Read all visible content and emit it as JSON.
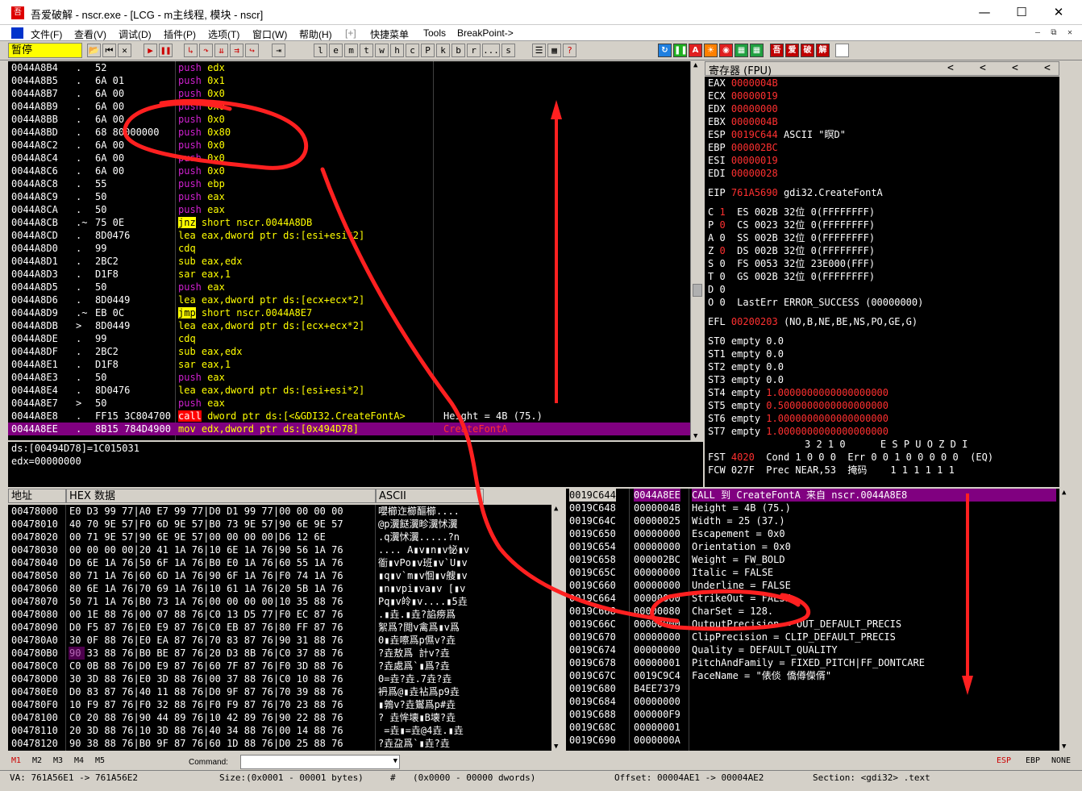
{
  "window": {
    "title": "吾爱破解 - nscr.exe - [LCG - m主线程, 模块 - nscr]",
    "icon_text": "吾",
    "controls": [
      "minimize-icon",
      "maximize-icon",
      "close-icon"
    ]
  },
  "menu": {
    "items": [
      "文件(F)",
      "查看(V)",
      "调试(D)",
      "插件(P)",
      "选项(T)",
      "窗口(W)",
      "帮助(H)",
      "[+]",
      "快捷菜单",
      "Tools",
      "BreakPoint->"
    ]
  },
  "toolbar": {
    "status": "暂停",
    "buttons": [
      "open-icon",
      "rewind-icon",
      "close-icon",
      "run-icon",
      "pause-icon",
      "step-into-icon",
      "step-over-icon",
      "trace-into-icon",
      "trace-over-icon",
      "execute-till-return-icon",
      "goto-icon"
    ],
    "letters": [
      "l",
      "e",
      "m",
      "t",
      "w",
      "h",
      "c",
      "P",
      "k",
      "b",
      "r",
      "...",
      "s"
    ],
    "colored": [
      "吾",
      "爱",
      "破",
      "解"
    ]
  },
  "disasm": {
    "rows": [
      {
        "addr": "0044A8B4",
        "mark": ".",
        "hex": "52",
        "mnem": "push",
        "ops": "edx"
      },
      {
        "addr": "0044A8B5",
        "mark": ".",
        "hex": "6A 01",
        "mnem": "push",
        "ops": "0x1"
      },
      {
        "addr": "0044A8B7",
        "mark": ".",
        "hex": "6A 00",
        "mnem": "push",
        "ops": "0x0"
      },
      {
        "addr": "0044A8B9",
        "mark": ".",
        "hex": "6A 00",
        "mnem": "push",
        "ops": "0x0"
      },
      {
        "addr": "0044A8BB",
        "mark": ".",
        "hex": "6A 00",
        "mnem": "push",
        "ops": "0x0"
      },
      {
        "addr": "0044A8BD",
        "mark": ".",
        "hex": "68 80000000",
        "mnem": "push",
        "ops": "0x80"
      },
      {
        "addr": "0044A8C2",
        "mark": ".",
        "hex": "6A 00",
        "mnem": "push",
        "ops": "0x0"
      },
      {
        "addr": "0044A8C4",
        "mark": ".",
        "hex": "6A 00",
        "mnem": "push",
        "ops": "0x0"
      },
      {
        "addr": "0044A8C6",
        "mark": ".",
        "hex": "6A 00",
        "mnem": "push",
        "ops": "0x0"
      },
      {
        "addr": "0044A8C8",
        "mark": ".",
        "hex": "55",
        "mnem": "push",
        "ops": "ebp"
      },
      {
        "addr": "0044A8C9",
        "mark": ".",
        "hex": "50",
        "mnem": "push",
        "ops": "eax"
      },
      {
        "addr": "0044A8CA",
        "mark": ".",
        "hex": "50",
        "mnem": "push",
        "ops": "eax"
      },
      {
        "addr": "0044A8CB",
        "mark": ".~",
        "hex": "75 0E",
        "mnem": "jnz",
        "ops": "short nscr.0044A8DB"
      },
      {
        "addr": "0044A8CD",
        "mark": ".",
        "hex": "8D0476",
        "mnem": "lea",
        "ops": "eax,dword ptr ds:[esi+esi*2]"
      },
      {
        "addr": "0044A8D0",
        "mark": ".",
        "hex": "99",
        "mnem": "cdq",
        "ops": ""
      },
      {
        "addr": "0044A8D1",
        "mark": ".",
        "hex": "2BC2",
        "mnem": "sub",
        "ops": "eax,edx"
      },
      {
        "addr": "0044A8D3",
        "mark": ".",
        "hex": "D1F8",
        "mnem": "sar",
        "ops": "eax,1"
      },
      {
        "addr": "0044A8D5",
        "mark": ".",
        "hex": "50",
        "mnem": "push",
        "ops": "eax"
      },
      {
        "addr": "0044A8D6",
        "mark": ".",
        "hex": "8D0449",
        "mnem": "lea",
        "ops": "eax,dword ptr ds:[ecx+ecx*2]"
      },
      {
        "addr": "0044A8D9",
        "mark": ".~",
        "hex": "EB 0C",
        "mnem": "jmp",
        "ops": "short nscr.0044A8E7"
      },
      {
        "addr": "0044A8DB",
        "mark": ">",
        "hex": "8D0449",
        "mnem": "lea",
        "ops": "eax,dword ptr ds:[ecx+ecx*2]"
      },
      {
        "addr": "0044A8DE",
        "mark": ".",
        "hex": "99",
        "mnem": "cdq",
        "ops": ""
      },
      {
        "addr": "0044A8DF",
        "mark": ".",
        "hex": "2BC2",
        "mnem": "sub",
        "ops": "eax,edx"
      },
      {
        "addr": "0044A8E1",
        "mark": ".",
        "hex": "D1F8",
        "mnem": "sar",
        "ops": "eax,1"
      },
      {
        "addr": "0044A8E3",
        "mark": ".",
        "hex": "50",
        "mnem": "push",
        "ops": "eax"
      },
      {
        "addr": "0044A8E4",
        "mark": ".",
        "hex": "8D0476",
        "mnem": "lea",
        "ops": "eax,dword ptr ds:[esi+esi*2]"
      },
      {
        "addr": "0044A8E7",
        "mark": ">",
        "hex": "50",
        "mnem": "push",
        "ops": "eax"
      },
      {
        "addr": "0044A8E8",
        "mark": ".",
        "hex": "FF15 3C804700",
        "mnem": "call",
        "ops": "dword ptr ds:[<&GDI32.CreateFontA>"
      },
      {
        "addr": "0044A8EE",
        "mark": ".",
        "hex": "8B15 784D4900",
        "mnem": "mov",
        "ops": "edx,dword ptr ds:[0x494D78]",
        "selected": true
      }
    ],
    "comments": [
      {
        "row": 27,
        "text": "Height = 4B (75.)"
      },
      {
        "row": 28,
        "text": "CreateFontA",
        "red": true
      }
    ]
  },
  "info": {
    "lines": [
      "ds:[00494D78]=1C015031",
      "edx=00000000"
    ]
  },
  "registers": {
    "header": "寄存器 (FPU)",
    "nav": [
      "<",
      "<",
      "<",
      "<"
    ],
    "gp": [
      {
        "name": "EAX",
        "value": "0000004B",
        "red": true,
        "comment": ""
      },
      {
        "name": "ECX",
        "value": "00000019",
        "red": true,
        "comment": ""
      },
      {
        "name": "EDX",
        "value": "00000000",
        "red": true,
        "comment": ""
      },
      {
        "name": "EBX",
        "value": "0000004B",
        "red": true,
        "comment": ""
      },
      {
        "name": "ESP",
        "value": "0019C644",
        "red": true,
        "comment": "ASCII \"瞑D\""
      },
      {
        "name": "EBP",
        "value": "000002BC",
        "red": true,
        "comment": ""
      },
      {
        "name": "ESI",
        "value": "00000019",
        "red": true,
        "comment": ""
      },
      {
        "name": "EDI",
        "value": "00000028",
        "red": true,
        "comment": ""
      }
    ],
    "eip": {
      "name": "EIP",
      "value": "761A5690",
      "comment": "gdi32.CreateFontA"
    },
    "flags": [
      {
        "f": "C",
        "v": "1",
        "red": true,
        "seg": "ES 002B 32位 0(FFFFFFFF)"
      },
      {
        "f": "P",
        "v": "0",
        "red": true,
        "seg": "CS 0023 32位 0(FFFFFFFF)"
      },
      {
        "f": "A",
        "v": "0",
        "red": false,
        "seg": "SS 002B 32位 0(FFFFFFFF)"
      },
      {
        "f": "Z",
        "v": "0",
        "red": true,
        "seg": "DS 002B 32位 0(FFFFFFFF)"
      },
      {
        "f": "S",
        "v": "0",
        "red": false,
        "seg": "FS 0053 32位 23E000(FFF)"
      },
      {
        "f": "T",
        "v": "0",
        "red": false,
        "seg": "GS 002B 32位 0(FFFFFFFF)"
      },
      {
        "f": "D",
        "v": "0",
        "red": false,
        "seg": ""
      },
      {
        "f": "O",
        "v": "0",
        "red": false,
        "seg": "LastErr ERROR_SUCCESS (00000000)"
      }
    ],
    "efl": {
      "name": "EFL",
      "value": "00200203",
      "comment": "(NO,B,NE,BE,NS,PO,GE,G)"
    },
    "fpu": [
      {
        "name": "ST0",
        "state": "empty",
        "value": "0.0",
        "red": false
      },
      {
        "name": "ST1",
        "state": "empty",
        "value": "0.0",
        "red": false
      },
      {
        "name": "ST2",
        "state": "empty",
        "value": "0.0",
        "red": false
      },
      {
        "name": "ST3",
        "state": "empty",
        "value": "0.0",
        "red": false
      },
      {
        "name": "ST4",
        "state": "empty",
        "value": "1.0000000000000000000",
        "red": true
      },
      {
        "name": "ST5",
        "state": "empty",
        "value": "0.5000000000000000000",
        "red": true
      },
      {
        "name": "ST6",
        "state": "empty",
        "value": "1.0000000000000000000",
        "red": true
      },
      {
        "name": "ST7",
        "state": "empty",
        "value": "1.0000000000000000000",
        "red": true
      }
    ],
    "fpu_header": "3 2 1 0      E S P U O Z D I",
    "fst": {
      "label": "FST",
      "value": "4020",
      "rest": "Cond 1 0 0 0  Err 0 0 1 0 0 0 0 0  (EQ)"
    },
    "fcw": {
      "label": "FCW",
      "value": "027F",
      "rest": "Prec NEAR,53  掩码    1 1 1 1 1 1"
    }
  },
  "dump": {
    "headers": [
      "地址",
      "HEX 数据",
      "ASCII"
    ],
    "rows": [
      {
        "addr": "00478000",
        "hex": "E0 D3 99 77|A0 E7 99 77|D0 D1 99 77|00 00 00 00",
        "ascii": "嚶櫛迮櫛醧櫛...."
      },
      {
        "addr": "00478010",
        "hex": "40 70 9E 57|F0 6D 9E 57|B0 73 9E 57|90 6E 9E 57",
        "ascii": "@p瀷餸瀷畛瀷怵瀷"
      },
      {
        "addr": "00478020",
        "hex": "00 71 9E 57|90 6E 9E 57|00 00 00 00|D6 12 6E",
        "ascii": ".q瀷怵瀷.....?n"
      },
      {
        "addr": "00478030",
        "hex": "00 00 00 00|20 41 1A 76|10 6E 1A 76|90 56 1A 76",
        "ascii": ".... A▮v▮n▮v怭▮v"
      },
      {
        "addr": "00478040",
        "hex": "D0 6E 1A 76|50 6F 1A 76|B0 E0 1A 76|60 55 1A 76",
        "ascii": "衜▮vPo▮v班▮v`U▮v"
      },
      {
        "addr": "00478050",
        "hex": "80 71 1A 76|60 6D 1A 76|90 6F 1A 76|F0 74 1A 76",
        "ascii": "▮q▮v`m▮v恛▮v艘▮v"
      },
      {
        "addr": "00478060",
        "hex": "80 6E 1A 76|70 69 1A 76|10 61 1A 76|20 5B 1A 76",
        "ascii": "▮n▮vpi▮va▮v [▮v"
      },
      {
        "addr": "00478070",
        "hex": "50 71 1A 76|B0 73 1A 76|00 00 00 00|10 35 88 76",
        "ascii": "Pq▮v皊▮v....▮5垚"
      },
      {
        "addr": "00478080",
        "hex": "00 1E 88 76|00 07 88 76|C0 13 D5 77|F0 EC 87 76",
        "ascii": ".▮垚.▮垚?諂痨爲"
      },
      {
        "addr": "00478090",
        "hex": "D0 F5 87 76|E0 E9 87 76|C0 EB 87 76|80 FF 87 76",
        "ascii": "絮爲?閲v禽爲▮v爲"
      },
      {
        "addr": "004780A0",
        "hex": "30 0F 88 76|E0 EA 87 76|70 83 87 76|90 31 88 76",
        "ascii": "0▮垚嚓爲p儑v?垚"
      },
      {
        "addr": "004780B0",
        "hex": "90 33 88 76|B0 BE 87 76|20 D3 8B 76|C0 37 88 76",
        "ascii": "?垚敖爲 計v?垚",
        "hl": true
      },
      {
        "addr": "004780C0",
        "hex": "C0 0B 88 76|D0 E9 87 76|60 7F 87 76|F0 3D 88 76",
        "ascii": "?垚處爲`▮爲?垚"
      },
      {
        "addr": "004780D0",
        "hex": "30 3D 88 76|E0 3D 88 76|00 37 88 76|C0 10 88 76",
        "ascii": "0=垚?垚.7垚?垚"
      },
      {
        "addr": "004780E0",
        "hex": "D0 83 87 76|40 11 88 76|D0 9F 87 76|70 39 88 76",
        "ascii": "袇爲@▮垚袩爲p9垚"
      },
      {
        "addr": "004780F0",
        "hex": "10 F9 87 76|F0 32 88 76|F0 F9 87 76|70 23 88 76",
        "ascii": "▮鶉v?垚鸑爲p#垚"
      },
      {
        "addr": "00478100",
        "hex": "C0 20 88 76|90 44 89 76|10 42 89 76|90 22 88 76",
        "ascii": "? 垚恈壊▮B壊?垚"
      },
      {
        "addr": "00478110",
        "hex": "20 3D 88 76|10 3D 88 76|40 34 88 76|00 14 88 76",
        "ascii": " =垚▮=垚@4垚.▮垚"
      },
      {
        "addr": "00478120",
        "hex": "90 38 88 76|B0 9F 87 76|60 1D 88 76|D0 25 88 76",
        "ascii": "?垚盁爲`▮垚?垚"
      }
    ]
  },
  "stack": {
    "rows": [
      {
        "addr": "0019C644",
        "val": "0044A8EE",
        "comment": "CALL 到 CreateFontA 来自 nscr.0044A8E8",
        "top": true
      },
      {
        "addr": "0019C648",
        "val": "0000004B",
        "comment": "Height = 4B (75.)"
      },
      {
        "addr": "0019C64C",
        "val": "00000025",
        "comment": "Width = 25 (37.)"
      },
      {
        "addr": "0019C650",
        "val": "00000000",
        "comment": "Escapement = 0x0"
      },
      {
        "addr": "0019C654",
        "val": "00000000",
        "comment": "Orientation = 0x0"
      },
      {
        "addr": "0019C658",
        "val": "000002BC",
        "comment": "Weight = FW_BOLD"
      },
      {
        "addr": "0019C65C",
        "val": "00000000",
        "comment": "Italic = FALSE"
      },
      {
        "addr": "0019C660",
        "val": "00000000",
        "comment": "Underline = FALSE"
      },
      {
        "addr": "0019C664",
        "val": "00000000",
        "comment": "StrikeOut = FALSE"
      },
      {
        "addr": "0019C668",
        "val": "00000080",
        "comment": "CharSet = 128."
      },
      {
        "addr": "0019C66C",
        "val": "00000000",
        "comment": "OutputPrecision = OUT_DEFAULT_PRECIS"
      },
      {
        "addr": "0019C670",
        "val": "00000000",
        "comment": "ClipPrecision = CLIP_DEFAULT_PRECIS"
      },
      {
        "addr": "0019C674",
        "val": "00000000",
        "comment": "Quality = DEFAULT_QUALITY"
      },
      {
        "addr": "0019C678",
        "val": "00000001",
        "comment": "PitchAndFamily = FIXED_PITCH|FF_DONTCARE"
      },
      {
        "addr": "0019C67C",
        "val": "0019C9C4",
        "comment": "FaceName = \"俵倓 僑僔儝偦\""
      },
      {
        "addr": "0019C680",
        "val": "B4EE7379",
        "comment": ""
      },
      {
        "addr": "0019C684",
        "val": "00000000",
        "comment": ""
      },
      {
        "addr": "0019C688",
        "val": "000000F9",
        "comment": ""
      },
      {
        "addr": "0019C68C",
        "val": "00000001",
        "comment": ""
      },
      {
        "addr": "0019C690",
        "val": "0000000A",
        "comment": ""
      }
    ]
  },
  "command": {
    "tabs": [
      "M1",
      "M2",
      "M3",
      "M4",
      "M5"
    ],
    "label": "Command:",
    "value": "",
    "right": [
      "ESP",
      "EBP",
      "NONE"
    ]
  },
  "status": {
    "items": [
      "VA: 761A56E1 -> 761A56E2",
      "Size:(0x0001 - 00001 bytes)",
      "#",
      "(0x0000 - 00000 dwords)",
      "Offset: 00004AE1 -> 00004AE2",
      "Section: <gdi32> .text"
    ]
  },
  "colors": {
    "annotation": "#ff2020",
    "push": "#d020d0",
    "highlight": "#800080"
  }
}
